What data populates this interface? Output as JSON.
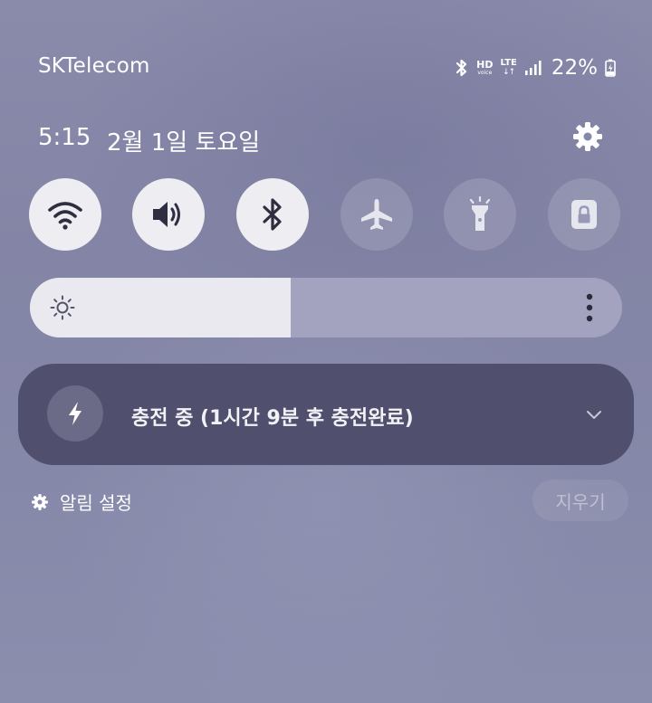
{
  "status_bar": {
    "carrier": "SKTelecom",
    "hd_voice": {
      "hd": "HD",
      "voice": "voice"
    },
    "network": {
      "type": "LTE",
      "arrows": "↓↑"
    },
    "battery_percent": "22%",
    "icons": [
      "bluetooth-icon",
      "hd-voice-icon",
      "lte-icon",
      "signal-icon",
      "battery-charging-icon"
    ]
  },
  "header": {
    "time": "5:15",
    "date": "2월 1일 토요일",
    "settings_icon": "gear-icon"
  },
  "quick_toggles": [
    {
      "name": "wifi",
      "icon": "wifi-icon",
      "state": "on"
    },
    {
      "name": "sound",
      "icon": "speaker-icon",
      "state": "on"
    },
    {
      "name": "bluetooth",
      "icon": "bluetooth-icon",
      "state": "on"
    },
    {
      "name": "airplane",
      "icon": "airplane-icon",
      "state": "off"
    },
    {
      "name": "flashlight",
      "icon": "flashlight-icon",
      "state": "off"
    },
    {
      "name": "secure-folder",
      "icon": "lock-icon",
      "state": "off"
    }
  ],
  "brightness": {
    "level": 0.44,
    "icon": "sun-icon",
    "more_icon": "more-vertical-icon"
  },
  "notification": {
    "icon": "lightning-icon",
    "text": "충전 중 (1시간 9분 후 충전완료)",
    "expand_icon": "chevron-down-icon"
  },
  "footer": {
    "settings_label": "알림 설정",
    "clear_label": "지우기"
  },
  "colors": {
    "toggle_on": "#ededf2",
    "toggle_icon_on": "#2e2e40",
    "notification_bg": "#504f6d",
    "brightness_fill": "#e9e9ef",
    "brightness_track": "#a3a3bf"
  }
}
